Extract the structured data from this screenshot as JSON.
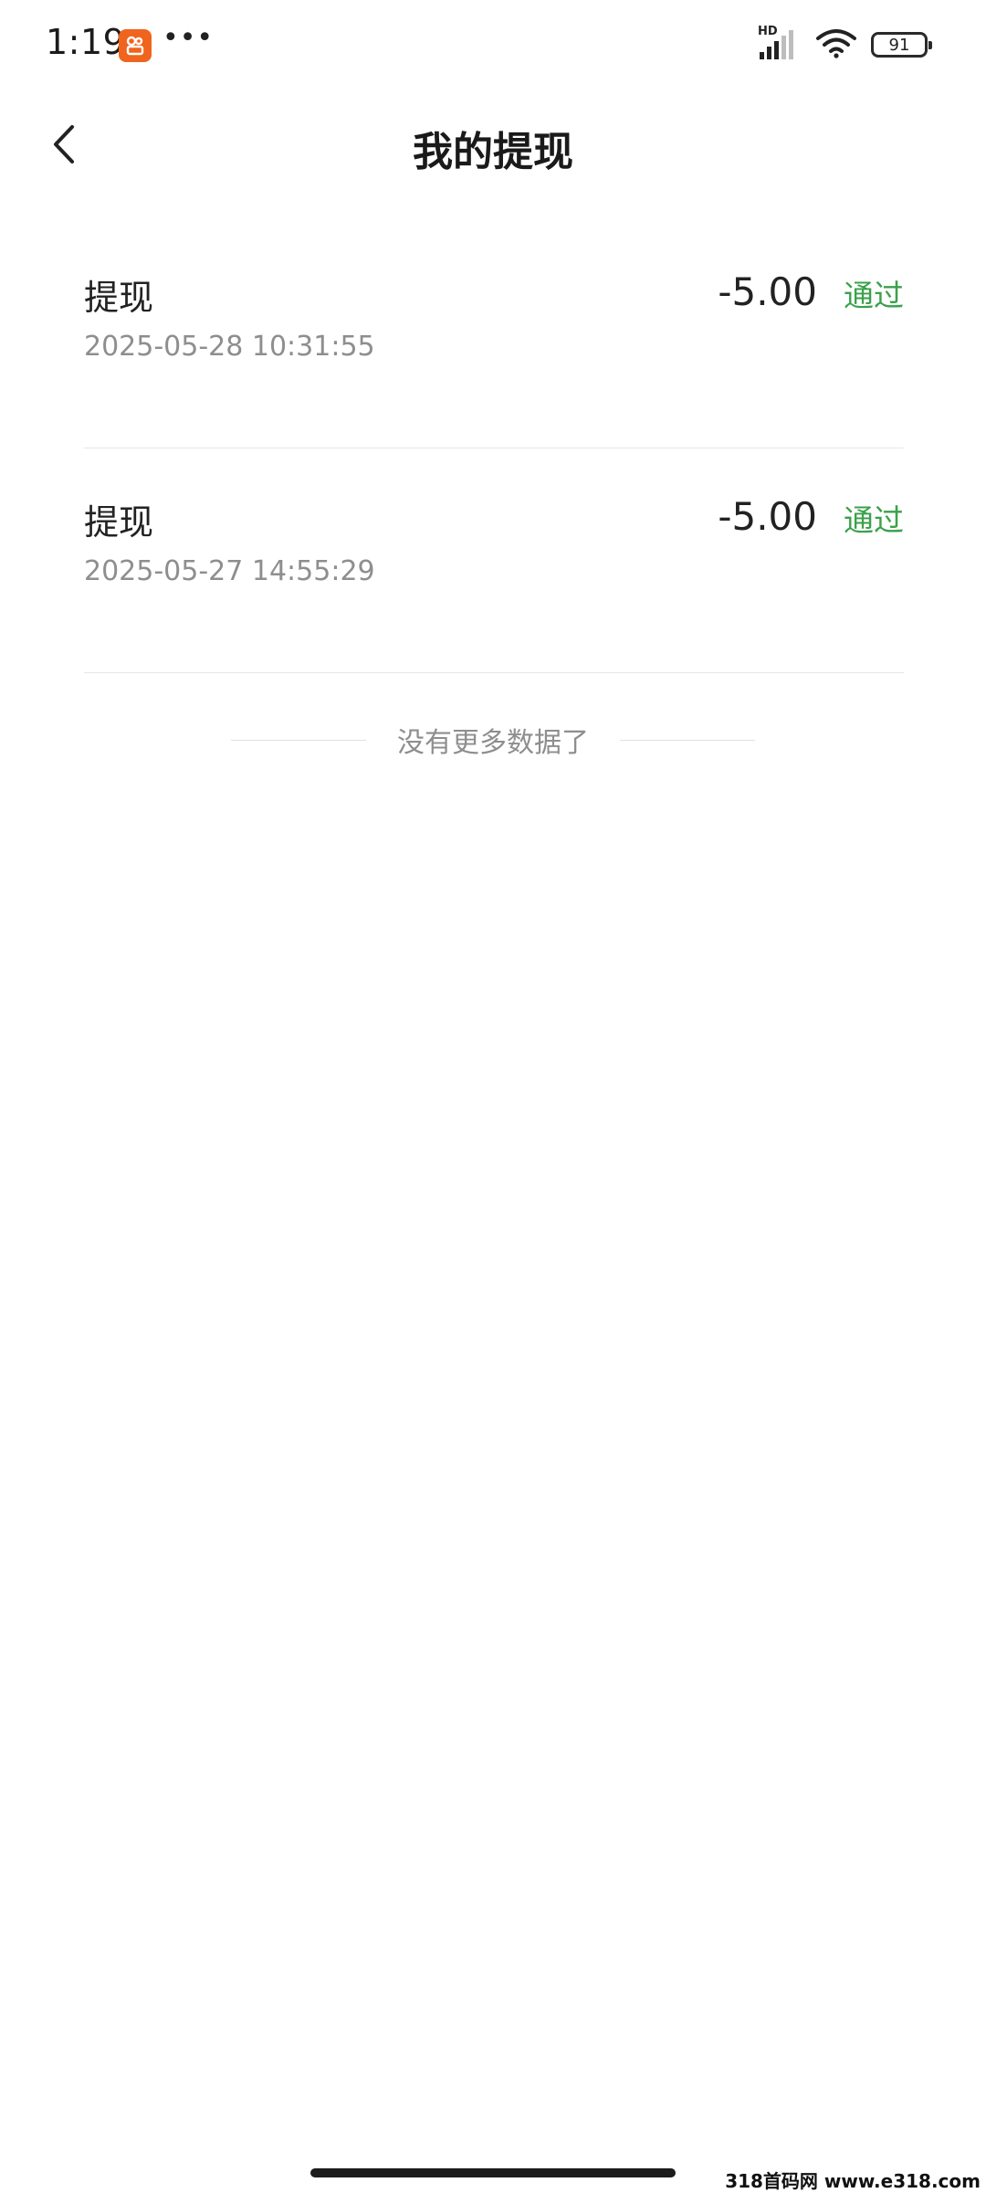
{
  "status_bar": {
    "time": "1:19",
    "more": "•••",
    "network_label": "HD",
    "battery_level": "91",
    "icons": [
      "app-notification-icon",
      "signal-icon",
      "wifi-icon",
      "battery-icon"
    ]
  },
  "nav": {
    "title": "我的提现",
    "back_icon": "chevron-left-icon"
  },
  "records": [
    {
      "type": "提现",
      "time": "2025-05-28 10:31:55",
      "amount": "-5.00",
      "status": "通过"
    },
    {
      "type": "提现",
      "time": "2025-05-27 14:55:29",
      "amount": "-5.00",
      "status": "通过"
    }
  ],
  "footer": {
    "no_more": "没有更多数据了"
  },
  "watermark": "318首码网 www.e318.com",
  "colors": {
    "status_pass": "#3aa14a",
    "app_badge": "#f0641e",
    "secondary_text": "#8e8e8e"
  }
}
